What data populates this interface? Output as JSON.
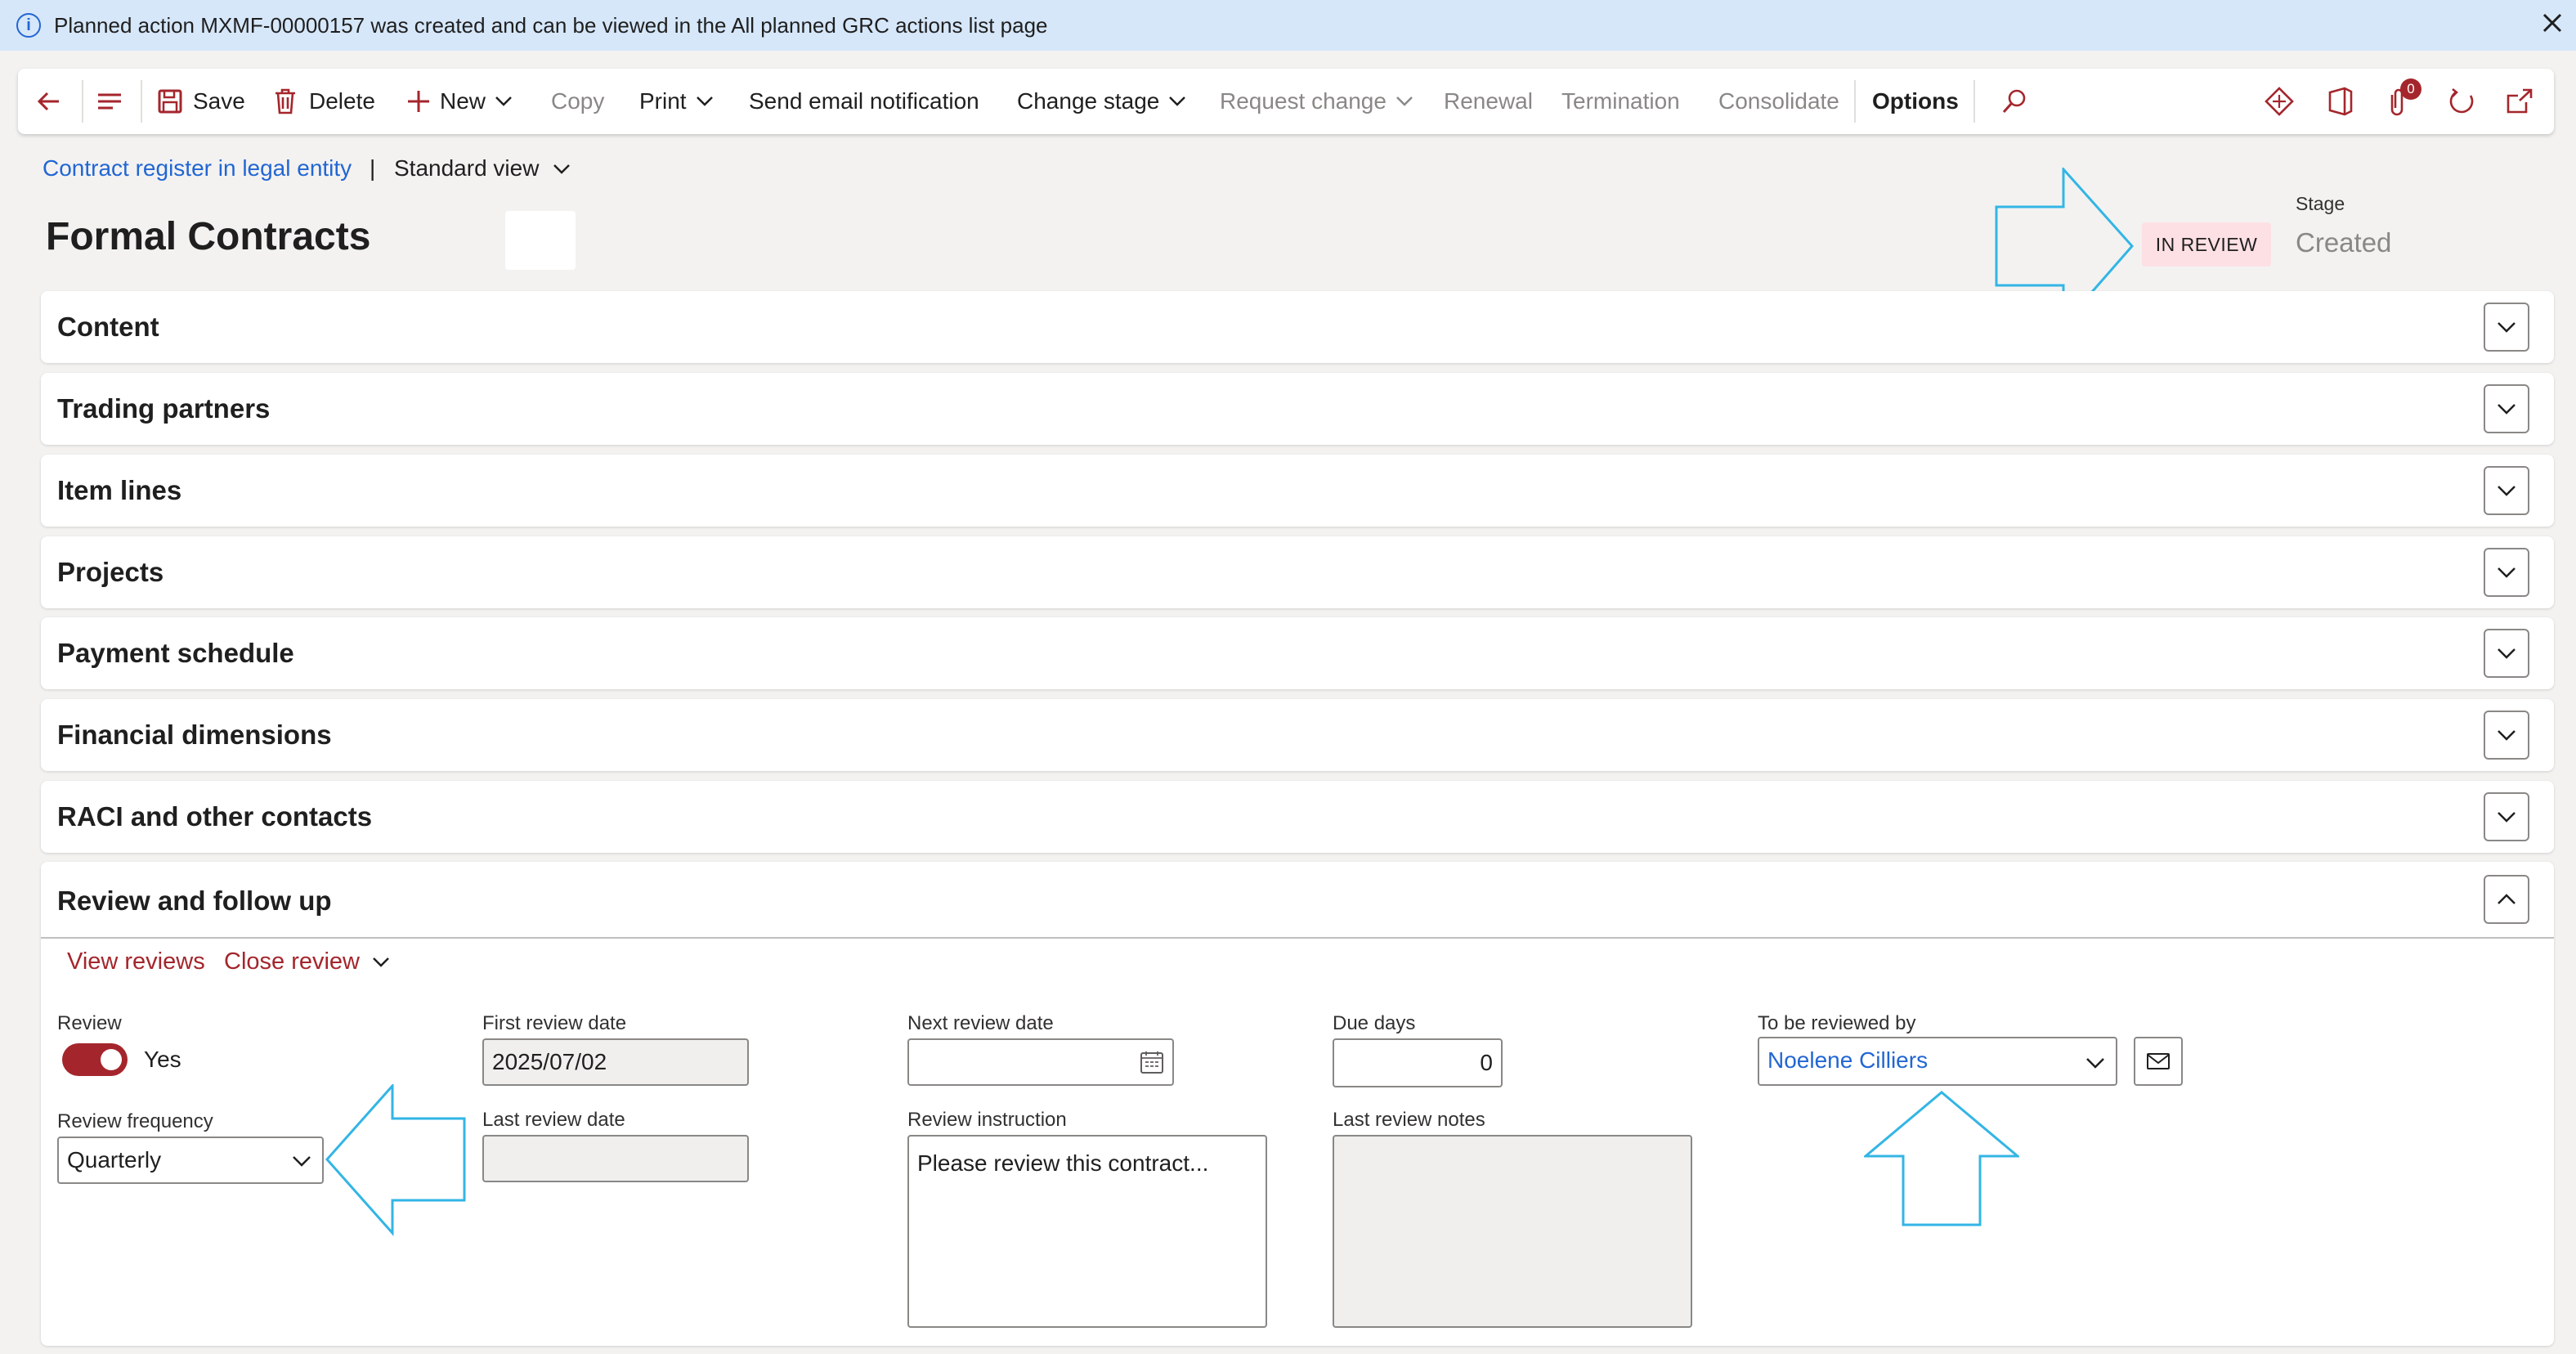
{
  "banner": {
    "message": "Planned action MXMF-00000157 was created and can be viewed in the All planned GRC actions list page"
  },
  "toolbar": {
    "save": "Save",
    "delete": "Delete",
    "new": "New",
    "copy": "Copy",
    "print": "Print",
    "send_email": "Send email notification",
    "change_stage": "Change stage",
    "request_change": "Request change",
    "renewal": "Renewal",
    "termination": "Termination",
    "consolidate": "Consolidate",
    "options": "Options",
    "attachments_count": "0"
  },
  "breadcrumb": {
    "link": "Contract register in legal entity",
    "separator": "|",
    "view": "Standard view"
  },
  "header": {
    "title": "Formal Contracts",
    "status_badge": "IN REVIEW",
    "stage_label": "Stage",
    "stage_value": "Created"
  },
  "sections": [
    "Content",
    "Trading partners",
    "Item lines",
    "Projects",
    "Payment schedule",
    "Financial dimensions",
    "RACI and other contacts"
  ],
  "review_section": {
    "title": "Review and follow up",
    "view_reviews": "View reviews",
    "close_review": "Close review",
    "review_label": "Review",
    "review_value": "Yes",
    "frequency_label": "Review frequency",
    "frequency_value": "Quarterly",
    "first_review_label": "First review date",
    "first_review_value": "2025/07/02",
    "last_review_label": "Last review date",
    "last_review_value": "",
    "next_review_label": "Next review date",
    "next_review_value": "",
    "instruction_label": "Review instruction",
    "instruction_value": "Please review this contract...",
    "due_days_label": "Due days",
    "due_days_value": "0",
    "last_notes_label": "Last review notes",
    "last_notes_value": "",
    "reviewer_label": "To be reviewed by",
    "reviewer_value": "Noelene Cilliers"
  },
  "colors": {
    "accent": "#a4262c",
    "link": "#2266d3",
    "banner_bg": "#d6e7fa",
    "badge_bg": "#fde0e4",
    "annotation_arrow": "#33b5e5"
  }
}
